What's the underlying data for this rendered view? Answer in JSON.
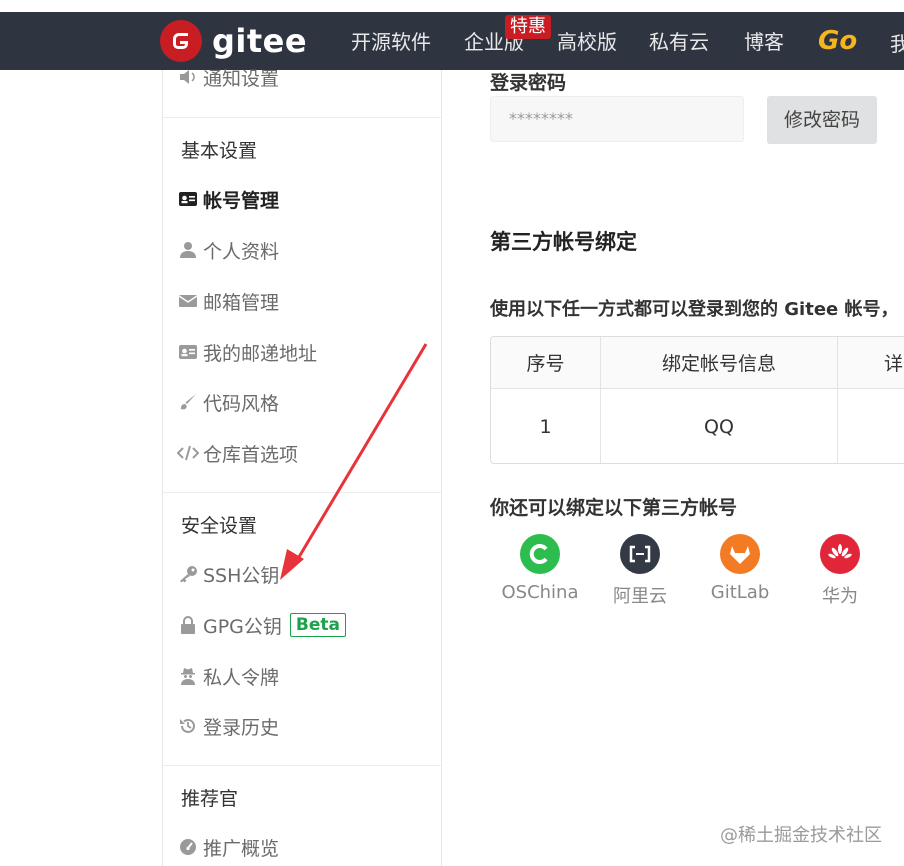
{
  "brand": {
    "name": "gitee"
  },
  "nav": {
    "items": [
      "开源软件",
      "企业版",
      "高校版",
      "私有云",
      "博客"
    ],
    "badge": "特惠",
    "go": "Go",
    "cut_item": "我"
  },
  "sidebar": {
    "top_item": "通知设置",
    "basic_head": "基本设置",
    "basic_items": [
      "帐号管理",
      "个人资料",
      "邮箱管理",
      "我的邮递地址",
      "代码风格",
      "仓库首选项"
    ],
    "security_head": "安全设置",
    "security_items": [
      "SSH公钥",
      "GPG公钥",
      "私人令牌",
      "登录历史"
    ],
    "beta_label": "Beta",
    "promo_head": "推荐官",
    "promo_items": [
      "推广概览"
    ]
  },
  "password": {
    "label": "登录密码",
    "value": "********",
    "button": "修改密码"
  },
  "third_party": {
    "title": "第三方帐号绑定",
    "description": "使用以下任一方式都可以登录到您的 Gitee 帐号，",
    "table": {
      "headers": [
        "序号",
        "绑定帐号信息",
        "详"
      ],
      "rows": [
        [
          "1",
          "QQ",
          ""
        ]
      ]
    },
    "also_title": "你还可以绑定以下第三方帐号",
    "providers": [
      {
        "name": "OSChina",
        "color": "#2dbd4e"
      },
      {
        "name": "阿里云",
        "color": "#333a45"
      },
      {
        "name": "GitLab",
        "color": "#f27b23"
      },
      {
        "name": "华为",
        "color": "#e2263a"
      }
    ]
  },
  "watermark": "@稀土掘金技术社区",
  "colors": {
    "navbar": "#2e3440",
    "brand_red": "#c71d23",
    "go_yellow": "#f5b51d",
    "beta_green": "#1aa34a",
    "arrow": "#e8333a"
  }
}
